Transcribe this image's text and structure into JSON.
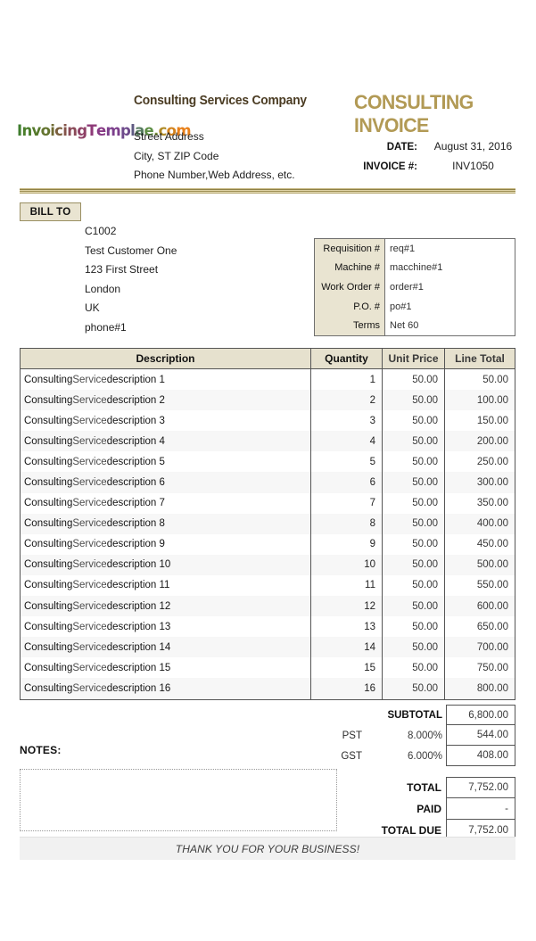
{
  "header": {
    "company_name": "Consulting Services Company",
    "doc_title": "CONSULTING INVOICE",
    "logo_text": "InvoicingTemplae.com",
    "logo_letters": [
      {
        "ch": "I",
        "color": "#3f7d2e"
      },
      {
        "ch": "n",
        "color": "#4a7e2b"
      },
      {
        "ch": "v",
        "color": "#55792b"
      },
      {
        "ch": "o",
        "color": "#63742f"
      },
      {
        "ch": "i",
        "color": "#6f6b33"
      },
      {
        "ch": "c",
        "color": "#7a5f3c"
      },
      {
        "ch": "i",
        "color": "#84544a"
      },
      {
        "ch": "n",
        "color": "#8a4a58"
      },
      {
        "ch": "g",
        "color": "#8e4166"
      },
      {
        "ch": "T",
        "color": "#8e3a78"
      },
      {
        "ch": "e",
        "color": "#873a85"
      },
      {
        "ch": "m",
        "color": "#7c3f8c"
      },
      {
        "ch": "p",
        "color": "#6e4a8b"
      },
      {
        "ch": "l",
        "color": "#5f5a82"
      },
      {
        "ch": "a",
        "color": "#557a5d"
      },
      {
        "ch": "e",
        "color": "#5d8e45"
      },
      {
        "ch": ".",
        "color": "#7a9138"
      },
      {
        "ch": "c",
        "color": "#b08b27"
      },
      {
        "ch": "o",
        "color": "#d4831e"
      },
      {
        "ch": "m",
        "color": "#e8801a"
      }
    ],
    "address_lines": [
      "Street Address",
      "City, ST  ZIP Code",
      "Phone Number,Web Address, etc."
    ],
    "meta": [
      {
        "label": "DATE:",
        "value": "August 31, 2016"
      },
      {
        "label": "INVOICE #:",
        "value": "INV1050"
      }
    ]
  },
  "bill_to": {
    "badge_label": "BILL TO",
    "lines": [
      "C1002",
      "Test Customer One",
      "123 First Street",
      "London",
      "UK",
      "phone#1"
    ]
  },
  "info_box": {
    "rows": [
      {
        "label": "Requisition #",
        "value": "req#1"
      },
      {
        "label": "Machine #",
        "value": "macchine#1"
      },
      {
        "label": "Work Order #",
        "value": "order#1"
      },
      {
        "label": "P.O. #",
        "value": "po#1"
      },
      {
        "label": "Terms",
        "value": "Net 60"
      }
    ]
  },
  "items_table": {
    "columns": [
      "Description",
      "Quantity",
      "Unit Price",
      "Line Total"
    ],
    "rows": [
      {
        "description": "Consulting Service description 1",
        "quantity": "1",
        "unit_price": "50.00",
        "line_total": "50.00"
      },
      {
        "description": "Consulting Service description 2",
        "quantity": "2",
        "unit_price": "50.00",
        "line_total": "100.00"
      },
      {
        "description": "Consulting Service description 3",
        "quantity": "3",
        "unit_price": "50.00",
        "line_total": "150.00"
      },
      {
        "description": "Consulting Service description 4",
        "quantity": "4",
        "unit_price": "50.00",
        "line_total": "200.00"
      },
      {
        "description": "Consulting Service description 5",
        "quantity": "5",
        "unit_price": "50.00",
        "line_total": "250.00"
      },
      {
        "description": "Consulting Service description 6",
        "quantity": "6",
        "unit_price": "50.00",
        "line_total": "300.00"
      },
      {
        "description": "Consulting Service description 7",
        "quantity": "7",
        "unit_price": "50.00",
        "line_total": "350.00"
      },
      {
        "description": "Consulting Service description 8",
        "quantity": "8",
        "unit_price": "50.00",
        "line_total": "400.00"
      },
      {
        "description": "Consulting Service description 9",
        "quantity": "9",
        "unit_price": "50.00",
        "line_total": "450.00"
      },
      {
        "description": "Consulting Service description 10",
        "quantity": "10",
        "unit_price": "50.00",
        "line_total": "500.00"
      },
      {
        "description": "Consulting Service description 11",
        "quantity": "11",
        "unit_price": "50.00",
        "line_total": "550.00"
      },
      {
        "description": "Consulting Service description 12",
        "quantity": "12",
        "unit_price": "50.00",
        "line_total": "600.00"
      },
      {
        "description": "Consulting Service description 13",
        "quantity": "13",
        "unit_price": "50.00",
        "line_total": "650.00"
      },
      {
        "description": "Consulting Service description 14",
        "quantity": "14",
        "unit_price": "50.00",
        "line_total": "700.00"
      },
      {
        "description": "Consulting Service description 15",
        "quantity": "15",
        "unit_price": "50.00",
        "line_total": "750.00"
      },
      {
        "description": "Consulting Service description 16",
        "quantity": "16",
        "unit_price": "50.00",
        "line_total": "800.00"
      }
    ]
  },
  "summary": {
    "subtotal": {
      "label": "SUBTOTAL",
      "value": "6,800.00"
    },
    "pst": {
      "name": "PST",
      "rate": "8.000%",
      "value": "544.00"
    },
    "gst": {
      "name": "GST",
      "rate": "6.000%",
      "value": "408.00"
    },
    "total": {
      "label": "TOTAL",
      "value": "7,752.00"
    },
    "paid": {
      "label": "PAID",
      "value": "-"
    },
    "total_due": {
      "label": "TOTAL DUE",
      "value": "7,752.00"
    }
  },
  "notes": {
    "label": "NOTES:",
    "value": ""
  },
  "footer": {
    "message": "THANK YOU FOR YOUR BUSINESS!"
  },
  "colors": {
    "title_gold": "#b29a55",
    "company_brown": "#4a3b22",
    "beige_fill": "#e9e4d1",
    "table_header": "#e6e1ce",
    "border": "#555555",
    "footer_bg": "#f1f1f1"
  }
}
